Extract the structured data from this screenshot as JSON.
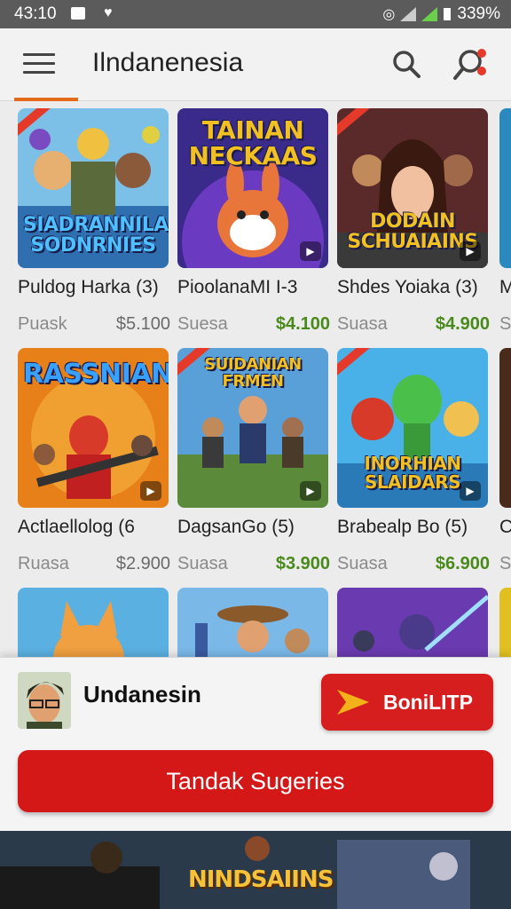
{
  "status_bar": {
    "time": "43:10",
    "battery": "339%"
  },
  "app_bar": {
    "title": "Ilndanenesia"
  },
  "games": [
    {
      "banner": "SIADRANNILAN SODNRNIES",
      "name": "Puldog Harka (3)",
      "label": "Puask",
      "price": "$5.100",
      "price_green": false
    },
    {
      "banner": "TAINAN NECKAAS",
      "name": "PioolanaMI I-3",
      "label": "Suesa",
      "price": "$4.100",
      "price_green": true
    },
    {
      "banner": "DODAIN SCHUAIAINS",
      "name": "Shdes Yoiaka (3)",
      "label": "Suasa",
      "price": "$4.900",
      "price_green": true
    },
    {
      "banner": "",
      "name": "M",
      "label": "S",
      "price": "",
      "price_green": false
    },
    {
      "banner": "RASSNIAN",
      "name": "Actlaellolog (6",
      "label": "Ruasa",
      "price": "$2.900",
      "price_green": false
    },
    {
      "banner": "SUIDANIAN FRMEN",
      "name": "DagsanGo (5)",
      "label": "Suasa",
      "price": "$3.900",
      "price_green": true
    },
    {
      "banner": "INORHIAN SLAIDARS",
      "name": "Brabealp Bo (5)",
      "label": "Suasa",
      "price": "$6.900",
      "price_green": true
    },
    {
      "banner": "",
      "name": "C",
      "label": "S",
      "price": "",
      "price_green": false
    },
    {
      "banner": "",
      "name": "",
      "label": "",
      "price": "",
      "price_green": false
    },
    {
      "banner": "",
      "name": "",
      "label": "",
      "price": "",
      "price_green": false
    },
    {
      "banner": "",
      "name": "",
      "label": "",
      "price": "",
      "price_green": false
    },
    {
      "banner": "",
      "name": "",
      "label": "",
      "price": "",
      "price_green": false
    }
  ],
  "bottom_sheet": {
    "title": "Undanesin",
    "play_button": "BoniLITP",
    "main_button": "Tandak Sugeries"
  },
  "promo": {
    "text": "NINDSAIINS"
  },
  "colors": {
    "accent": "#d41717",
    "tab_indicator": "#e46a1c",
    "price_green": "#4a8a1c"
  }
}
